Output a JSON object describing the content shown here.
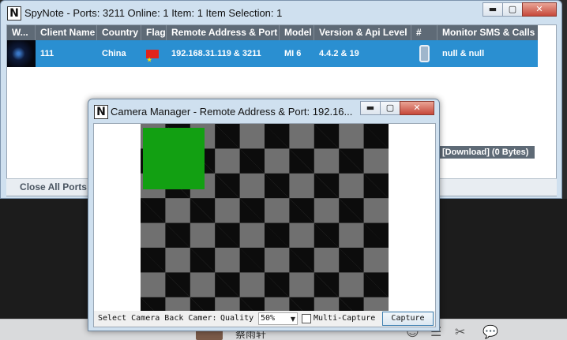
{
  "main_window": {
    "title": "SpyNote - Ports: 3211 Online: 1 Item: 1 Item Selection: 1",
    "logo": "N",
    "controls": {
      "minimize": "▬",
      "maximize": "▢",
      "close": "✕"
    },
    "columns": [
      "W...",
      "Client Name",
      "Country",
      "Flag",
      "Remote Address & Port",
      "Model",
      "Version & Api Level",
      "#",
      "Monitor SMS & Calls"
    ],
    "rows": [
      {
        "client_name": "111",
        "country": "China",
        "flag_icon": "china-flag-icon",
        "remote_address": "192.168.31.119 & 3211",
        "model": "MI 6",
        "version": "4.4.2 & 19",
        "device_icon": "phone-icon",
        "monitor": "null & null"
      }
    ],
    "download_status": "[Download] (0 Bytes)",
    "close_all_ports": "Close All Ports"
  },
  "camera_window": {
    "title": "Camera Manager - Remote Address & Port: 192.16...",
    "logo": "N",
    "controls": {
      "minimize": "▬",
      "maximize": "▢",
      "close": "✕"
    },
    "camera_label": "Select Camera Back Camer:",
    "quality_label": "Quality",
    "quality_value": "50%",
    "multi_capture_label": "Multi-Capture",
    "multi_capture_checked": false,
    "capture_button": "Capture"
  },
  "desktop": {
    "contact_name": "蔡雨轩",
    "tray_icons": [
      "☺",
      "☰",
      "✂",
      "💬"
    ]
  }
}
